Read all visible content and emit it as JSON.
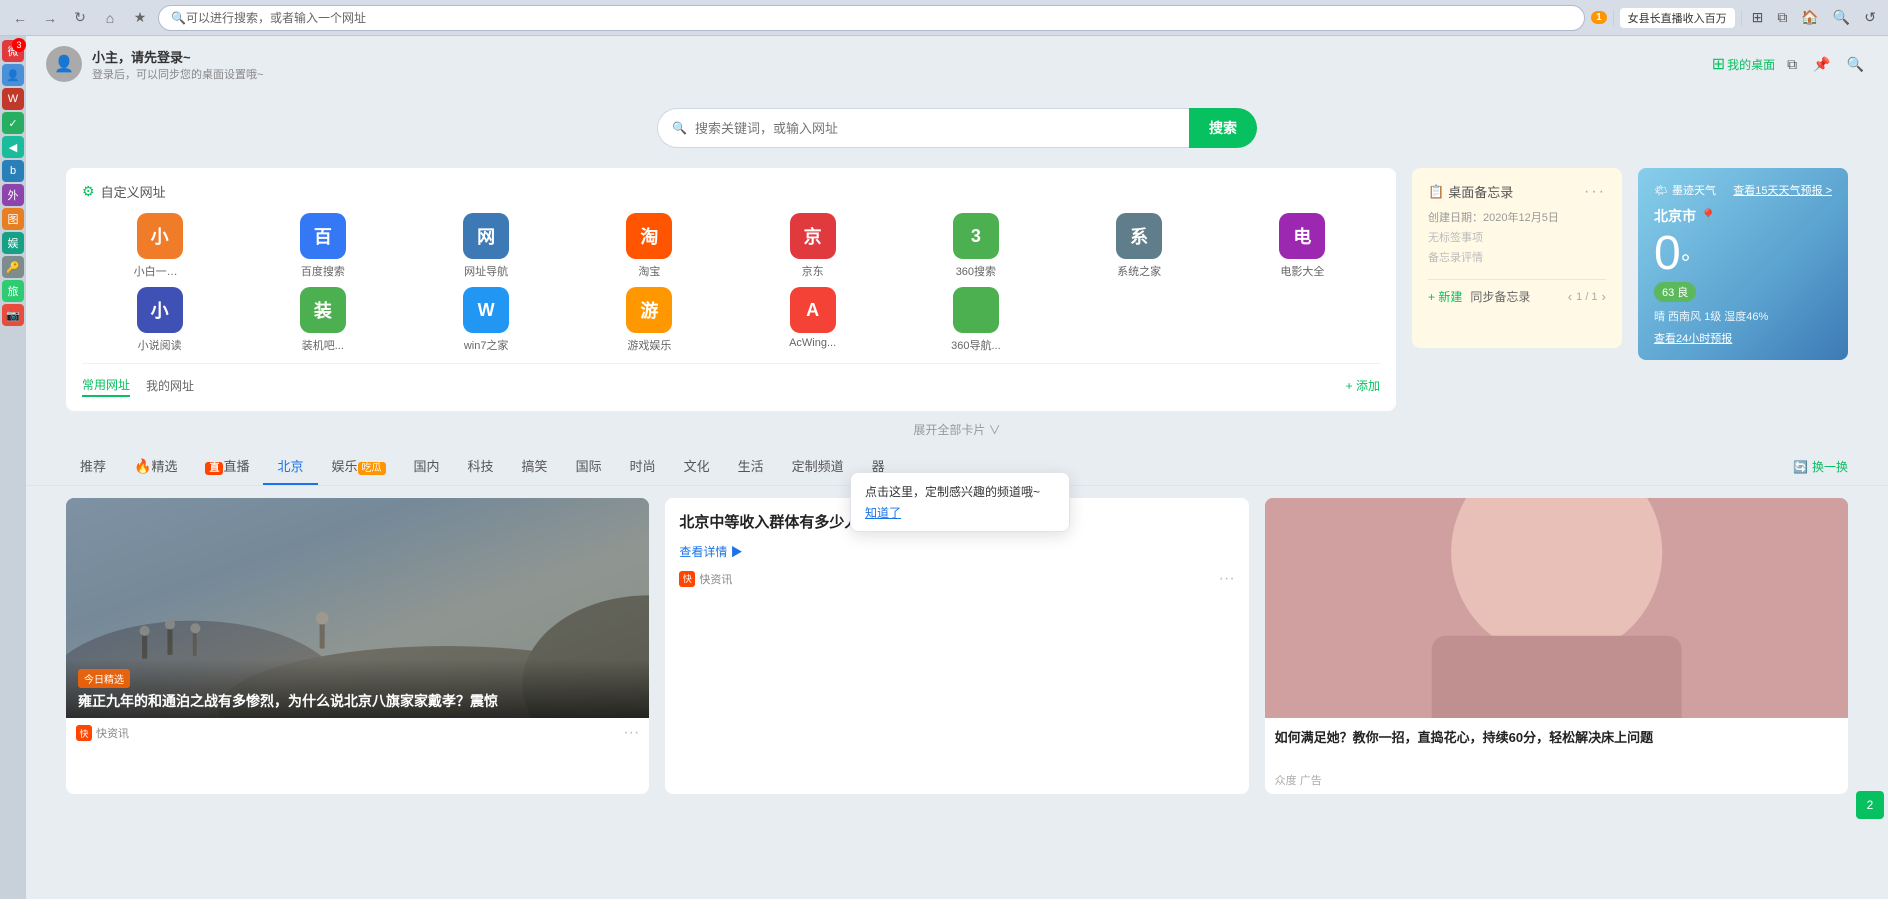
{
  "browser": {
    "address_placeholder": "可以进行搜索，或者输入一个网址",
    "news_ticker": "女县长直播收入百万",
    "lightning_count": "1"
  },
  "profile": {
    "name": "小主，请先登录~",
    "hint": "登录后，可以同步您的桌面设置哦~",
    "my_desktop": "我的桌面"
  },
  "search": {
    "placeholder": "搜索关键词，或输入网址",
    "btn_label": "搜索"
  },
  "quick_links": {
    "title": "自定义网址",
    "tabs": [
      "常用网址",
      "我的网址"
    ],
    "add_label": "+ 添加",
    "icons": [
      {
        "label": "小白一键...",
        "char": "小",
        "color": "#f07c2a"
      },
      {
        "label": "百度搜索",
        "char": "百",
        "color": "#3478f6"
      },
      {
        "label": "网址导航",
        "char": "网",
        "color": "#3d7ab5"
      },
      {
        "label": "淘宝",
        "char": "淘",
        "color": "#ff5500"
      },
      {
        "label": "京东",
        "char": "京",
        "color": "#e0393e"
      },
      {
        "label": "360搜索",
        "char": "3",
        "color": "#4caf50"
      },
      {
        "label": "系统之家",
        "char": "系",
        "color": "#607d8b"
      },
      {
        "label": "电影大全",
        "char": "电",
        "color": "#9c27b0"
      },
      {
        "label": "小说阅读",
        "char": "小",
        "color": "#3f51b5"
      },
      {
        "label": "装机吧...",
        "char": "装",
        "color": "#4caf50"
      },
      {
        "label": "win7之家",
        "char": "W",
        "color": "#2196f3"
      },
      {
        "label": "游戏娱乐",
        "char": "游",
        "color": "#ff9800"
      },
      {
        "label": "AcWing...",
        "char": "A",
        "color": "#f44336"
      },
      {
        "label": "360导航...",
        "char": "",
        "color": "#4caf50"
      }
    ]
  },
  "memo": {
    "title": "桌面备忘录",
    "date": "创建日期：2020年12月5日",
    "no_tag": "无标签事项",
    "hint": "备忘录评情",
    "new_label": "+ 新建",
    "sync_label": "同步备忘录",
    "page": "1 / 1"
  },
  "weather": {
    "brand": "墨迹天气",
    "forecast_label": "查看15天天气预报 >",
    "city": "北京市 📍",
    "temp": "0",
    "temp_unit": "°",
    "quality": "63 良",
    "wind": "晴  西南风 1级  湿度46%",
    "hour24_label": "查看24小时预报"
  },
  "expand": {
    "label": "展开全部卡片 ∨"
  },
  "news_tabs": [
    {
      "label": "推荐",
      "type": "normal"
    },
    {
      "label": "精选",
      "type": "fire"
    },
    {
      "label": "直播",
      "type": "live"
    },
    {
      "label": "北京",
      "type": "active"
    },
    {
      "label": "娱乐",
      "type": "hot"
    },
    {
      "label": "国内",
      "type": "normal"
    },
    {
      "label": "科技",
      "type": "normal"
    },
    {
      "label": "搞笑",
      "type": "normal"
    },
    {
      "label": "国际",
      "type": "normal"
    },
    {
      "label": "时尚",
      "type": "normal"
    },
    {
      "label": "文化",
      "type": "normal"
    },
    {
      "label": "生活",
      "type": "normal"
    },
    {
      "label": "定制频道",
      "type": "normal"
    },
    {
      "label": "器",
      "type": "icon"
    }
  ],
  "news_refresh": "换一换",
  "news_items": [
    {
      "type": "image_overlay",
      "tag": "今日精选",
      "title": "雍正九年的和通泊之战有多惨烈，为什么说北京八旗家家戴孝？震惊",
      "source": "快资讯",
      "source_color": "#ff4500"
    },
    {
      "type": "text",
      "title": "北京中等收入群体有多少人？市委改革办给出数据",
      "view_label": "查看详情 ▶",
      "source": "快资讯"
    },
    {
      "type": "image_plain",
      "title": "如何满足她？教你一招，直捣花心，持续60分，轻松解决床上问题",
      "source_label": "众度 广告"
    }
  ],
  "tooltip": {
    "text": "点击这里，定制感兴趣的频道哦~",
    "link": "知道了"
  },
  "sidebar_apps": [
    {
      "char": "微",
      "color": "#e0393e",
      "badge": "3"
    },
    {
      "char": "👤",
      "color": "#4a90d9",
      "badge": null
    },
    {
      "char": "W",
      "color": "#c0392b",
      "badge": null
    },
    {
      "char": "✓",
      "color": "#27ae60",
      "badge": null
    },
    {
      "char": "◀",
      "color": "#1abc9c",
      "badge": null
    },
    {
      "char": "b",
      "color": "#2980b9",
      "badge": null
    },
    {
      "char": "外",
      "color": "#8e44ad",
      "badge": null
    },
    {
      "char": "图",
      "color": "#e67e22",
      "badge": null
    },
    {
      "char": "娱",
      "color": "#16a085",
      "badge": null
    },
    {
      "char": "🔑",
      "color": "#7f8c8d",
      "badge": null
    },
    {
      "char": "旅",
      "color": "#2ecc71",
      "badge": null
    },
    {
      "char": "📷",
      "color": "#e74c3c",
      "badge": null
    }
  ]
}
